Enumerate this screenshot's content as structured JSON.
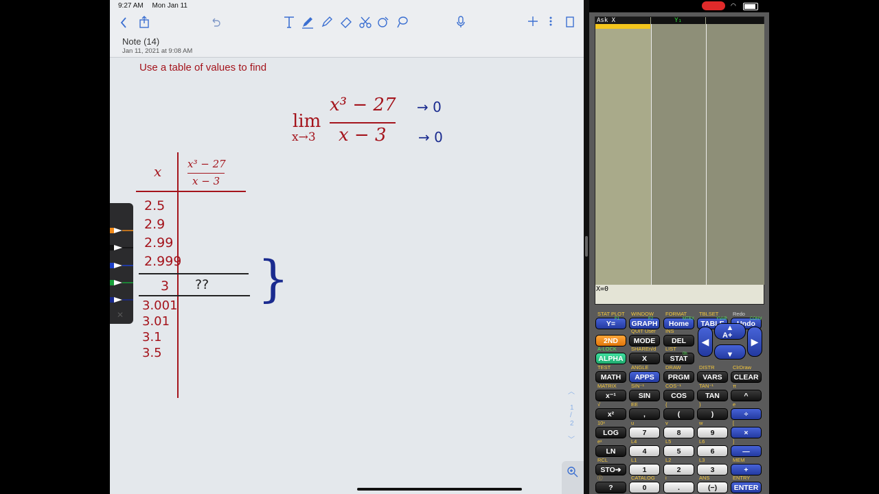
{
  "status": {
    "time": "9:27 AM",
    "date": "Mon Jan 11"
  },
  "toolbar": {
    "back_icon": "chevron-left-icon",
    "share_icon": "share-icon",
    "undo_icon": "undo-icon",
    "text_icon": "text-tool-icon",
    "pen_icon": "pen-icon",
    "highlighter_icon": "highlighter-icon",
    "eraser_icon": "eraser-icon",
    "scissors_icon": "scissors-icon",
    "shapes_icon": "shapes-icon",
    "lasso_icon": "lasso-icon",
    "mic_icon": "microphone-icon",
    "add_icon": "plus-icon",
    "more_icon": "more-icon",
    "pages_icon": "pages-icon"
  },
  "note": {
    "title": "Note (14)",
    "date": "Jan 11, 2021 at 9:08 AM"
  },
  "content": {
    "prompt": "Use a table of values to find",
    "limit": {
      "lim": "lim",
      "sub": "x→3",
      "num": "x³ − 27",
      "den": "x − 3",
      "num_arrow": "→ 0",
      "den_arrow": "→ 0"
    },
    "table": {
      "col_x": "x",
      "col_f_num": "x³ − 27",
      "col_f_den": "x − 3",
      "left_values": [
        "2.5",
        "2.9",
        "2.99",
        "2.999"
      ],
      "center_value": "3",
      "center_result": "??",
      "right_values": [
        "3.001",
        "3.01",
        "3.1",
        "3.5"
      ]
    },
    "page_nav": {
      "current": "1",
      "sep": "/",
      "total": "2"
    }
  },
  "calc": {
    "columns": [
      {
        "head": "Ask X"
      },
      {
        "head": "Y₁"
      },
      {
        "head": ""
      }
    ],
    "entry": "X=0",
    "keys": [
      {
        "top": "STAT PLOT",
        "sub": "F1",
        "label": "Y=",
        "style": "blue"
      },
      {
        "top": "WINDOW",
        "sub": "F2",
        "label": "GRAPH",
        "style": "blue"
      },
      {
        "top": "FORMAT",
        "sub": "MTRX",
        "label": "Home",
        "style": "blue"
      },
      {
        "top": "TBLSET",
        "sub": "YVAR",
        "label": "TABLE",
        "style": "blue"
      },
      {
        "top": "Redo",
        "sub": "CONV",
        "label": "Undo",
        "style": "blue"
      },
      {
        "top": "",
        "sub": "",
        "label": "2ND",
        "style": "orange"
      },
      {
        "top": "QUIT User",
        "sub": "",
        "label": "MODE",
        "style": "dark"
      },
      {
        "top": "INS",
        "sub": "",
        "label": "DEL",
        "style": "dark"
      },
      {
        "top": "A-LOCK",
        "sub": "",
        "label": "ALPHA",
        "style": "green"
      },
      {
        "top": "SHAREn/d",
        "sub": "",
        "label": "X",
        "style": "dark"
      },
      {
        "top": "LIST",
        "sub": "0h",
        "label": "STAT",
        "style": "dark"
      },
      {
        "top": "TEST",
        "sub": "",
        "label": "MATH",
        "style": "dark"
      },
      {
        "top": "ANGLE",
        "sub": "",
        "label": "APPS",
        "style": "blue"
      },
      {
        "top": "DRAW",
        "sub": "",
        "label": "PRGM",
        "style": "dark"
      },
      {
        "top": "DISTR",
        "sub": "",
        "label": "VARS",
        "style": "dark"
      },
      {
        "top": "ClrDraw",
        "sub": "",
        "label": "CLEAR",
        "style": "dark"
      },
      {
        "top": "MATRIX",
        "sub": "",
        "label": "x⁻¹",
        "style": "dark"
      },
      {
        "top": "SIN⁻¹",
        "sub": "",
        "label": "SIN",
        "style": "dark"
      },
      {
        "top": "COS⁻¹",
        "sub": "",
        "label": "COS",
        "style": "dark"
      },
      {
        "top": "TAN⁻¹",
        "sub": "",
        "label": "TAN",
        "style": "dark"
      },
      {
        "top": "π",
        "sub": "",
        "label": "^",
        "style": "dark"
      },
      {
        "top": "√",
        "sub": "",
        "label": "x²",
        "style": "dark"
      },
      {
        "top": "EE",
        "sub": "",
        "label": ",",
        "style": "dark"
      },
      {
        "top": "{",
        "sub": "",
        "label": "(",
        "style": "dark"
      },
      {
        "top": "}",
        "sub": "",
        "label": ")",
        "style": "dark"
      },
      {
        "top": "e",
        "sub": "",
        "label": "÷",
        "style": "blue"
      },
      {
        "top": "10ˣ",
        "sub": "",
        "label": "LOG",
        "style": "dark"
      },
      {
        "top": "u",
        "sub": "",
        "label": "7",
        "style": "light"
      },
      {
        "top": "v",
        "sub": "",
        "label": "8",
        "style": "light"
      },
      {
        "top": "w",
        "sub": "",
        "label": "9",
        "style": "light"
      },
      {
        "top": "[",
        "sub": "",
        "label": "×",
        "style": "blue"
      },
      {
        "top": "eˣ",
        "sub": "",
        "label": "LN",
        "style": "dark"
      },
      {
        "top": "L4",
        "sub": "",
        "label": "4",
        "style": "light"
      },
      {
        "top": "L5",
        "sub": "",
        "label": "5",
        "style": "light"
      },
      {
        "top": "L6",
        "sub": "",
        "label": "6",
        "style": "light"
      },
      {
        "top": "]",
        "sub": "",
        "label": "—",
        "style": "blue"
      },
      {
        "top": "RCL",
        "sub": "",
        "label": "STO➔",
        "style": "dark"
      },
      {
        "top": "L1",
        "sub": "",
        "label": "1",
        "style": "light"
      },
      {
        "top": "L2",
        "sub": "",
        "label": "2",
        "style": "light"
      },
      {
        "top": "L3",
        "sub": "",
        "label": "3",
        "style": "light"
      },
      {
        "top": "MEM",
        "sub": "",
        "label": "+",
        "style": "blue"
      },
      {
        "top": "ⓘ",
        "sub": "",
        "label": "?",
        "style": "dark"
      },
      {
        "top": "CATALOG",
        "sub": "",
        "label": "0",
        "style": "light"
      },
      {
        "top": "i",
        "sub": "",
        "label": ".",
        "style": "light"
      },
      {
        "top": "ANS",
        "sub": "",
        "label": "(−)",
        "style": "light"
      },
      {
        "top": "ENTRY",
        "sub": "",
        "label": "ENTER",
        "style": "blue"
      }
    ],
    "dpad_center": "A+"
  }
}
